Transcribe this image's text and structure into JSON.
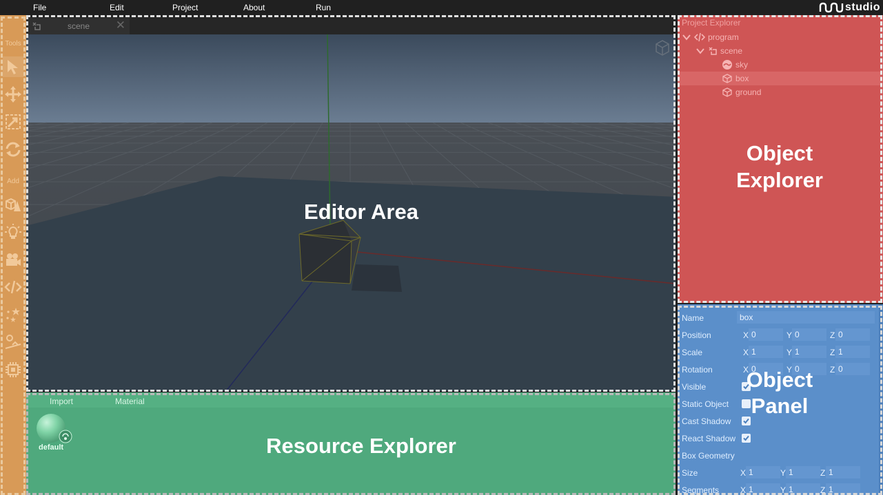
{
  "menu": {
    "items": [
      "File",
      "Edit",
      "Project",
      "About",
      "Run"
    ],
    "logo_text": "studio"
  },
  "toolbar": {
    "sections": {
      "tools": "Tools",
      "add": "Add"
    },
    "tool_icons": [
      "select-arrow-icon",
      "move-icon",
      "resize-icon",
      "rotate-icon"
    ],
    "add_icons": [
      "add-primitive-icon",
      "add-light-icon",
      "add-camera-icon",
      "add-script-icon",
      "add-particles-icon",
      "add-physics-icon",
      "add-chip-icon"
    ]
  },
  "editor": {
    "tab_label": "scene",
    "tab_close": "✕",
    "overlay_label": "Editor Area"
  },
  "resources": {
    "tabs": [
      "Import",
      "Material"
    ],
    "items": [
      {
        "label": "default"
      }
    ],
    "overlay_label": "Resource Explorer"
  },
  "explorer": {
    "title": "Project Explorer",
    "tree": [
      {
        "label": "program",
        "icon": "code-icon",
        "expanded": true,
        "level": 0
      },
      {
        "label": "scene",
        "icon": "scene-icon",
        "expanded": true,
        "level": 1
      },
      {
        "label": "sky",
        "icon": "sky-icon",
        "level": 2
      },
      {
        "label": "box",
        "icon": "cube-icon",
        "level": 2,
        "selected": true
      },
      {
        "label": "ground",
        "icon": "cube-icon",
        "level": 2
      }
    ],
    "overlay_label_line1": "Object",
    "overlay_label_line2": "Explorer"
  },
  "panel": {
    "name_label": "Name",
    "name_value": "box",
    "position": {
      "label": "Position",
      "x": "0",
      "y": "0",
      "z": "0"
    },
    "scale": {
      "label": "Scale",
      "x": "1",
      "y": "1",
      "z": "1"
    },
    "rotation": {
      "label": "Rotation",
      "x": "0",
      "y": "0",
      "z": "0"
    },
    "visible": {
      "label": "Visible",
      "checked": true
    },
    "static_object": {
      "label": "Static Object",
      "checked": false
    },
    "cast_shadow": {
      "label": "Cast Shadow",
      "checked": true
    },
    "react_shadow": {
      "label": "React Shadow",
      "checked": true
    },
    "geometry_header": "Box Geometry",
    "size": {
      "label": "Size",
      "x": "1",
      "y": "1",
      "z": "1"
    },
    "segments": {
      "label": "Segments",
      "x": "1",
      "y": "1",
      "z": "1"
    },
    "axis_labels": {
      "x": "X",
      "y": "Y",
      "z": "Z"
    },
    "overlay_label_line1": "Object",
    "overlay_label_line2": "Panel"
  },
  "colors": {
    "menubar": "#202020",
    "toolbar": "#d89a57",
    "editor_bg": "#394553",
    "resources": "#4fa97d",
    "explorer": "#cf5555",
    "panel": "#5b8fca"
  }
}
